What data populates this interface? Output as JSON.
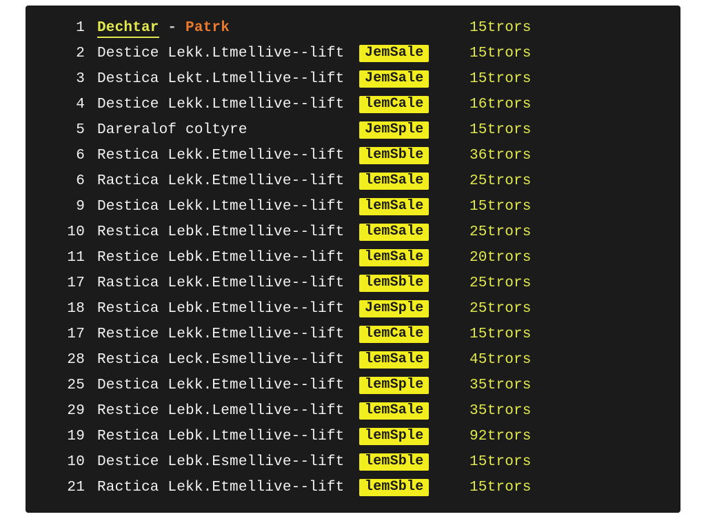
{
  "header": {
    "num": "1",
    "a": "Dechtar",
    "sep": " - ",
    "b": "Patrk",
    "time": "15trors"
  },
  "rows": [
    {
      "num": "2",
      "main": "Destice Lekk.Ltmellive--lift",
      "tag": "JemSale",
      "time": "15trors"
    },
    {
      "num": "3",
      "main": "Destica Lekt.Ltmellive--lift",
      "tag": "JemSale",
      "time": "15trors"
    },
    {
      "num": "4",
      "main": "Destice Lekk.Ltmellive--lift",
      "tag": "lemCale",
      "time": "16trors"
    },
    {
      "num": "5",
      "main": "Dareralof coltyre",
      "tag": "JemSple",
      "time": "15trors"
    },
    {
      "num": "6",
      "main": "Restica Lekk.Etmellive--lift",
      "tag": "lemSble",
      "time": "36trors"
    },
    {
      "num": "6",
      "main": "Ractica Lekk.Etmellive--lift",
      "tag": "lemSale",
      "time": "25trors"
    },
    {
      "num": "9",
      "main": "Destica Lekk.Ltmellive--lift",
      "tag": "lemSale",
      "time": "15trors"
    },
    {
      "num": "10",
      "main": "Restica Lebk.Etmellive--lift",
      "tag": "lemSale",
      "time": "25trors"
    },
    {
      "num": "11",
      "main": "Restice Lebk.Etmellive--lift",
      "tag": "lemSale",
      "time": "20trors"
    },
    {
      "num": "17",
      "main": "Rastica Lekk.Etmellive--lift",
      "tag": "lemSble",
      "time": "25trors"
    },
    {
      "num": "18",
      "main": "Restica Lebk.Etmellive--lift",
      "tag": "JemSple",
      "time": "25trors"
    },
    {
      "num": "17",
      "main": "Restice Lekk.Etmellive--lift",
      "tag": "lemCale",
      "time": "15trors"
    },
    {
      "num": "28",
      "main": "Restica Leck.Esmellive--lift",
      "tag": "lemSale",
      "time": "45trors"
    },
    {
      "num": "25",
      "main": "Destica Lekk.Etmellive--lift",
      "tag": "lemSple",
      "time": "35trors"
    },
    {
      "num": "29",
      "main": "Restice Lebk.Lemellive--lift",
      "tag": "lemSale",
      "time": "35trors"
    },
    {
      "num": "19",
      "main": "Restica Lebk.Ltmellive--lift",
      "tag": "lemSple",
      "time": "92trors"
    },
    {
      "num": "10",
      "main": "Destice Lebk.Esmellive--lift",
      "tag": "lemSble",
      "time": "15trors"
    },
    {
      "num": "21",
      "main": "Ractica Lekk.Etmellive--lift",
      "tag": "lemSble",
      "time": "15trors"
    }
  ]
}
